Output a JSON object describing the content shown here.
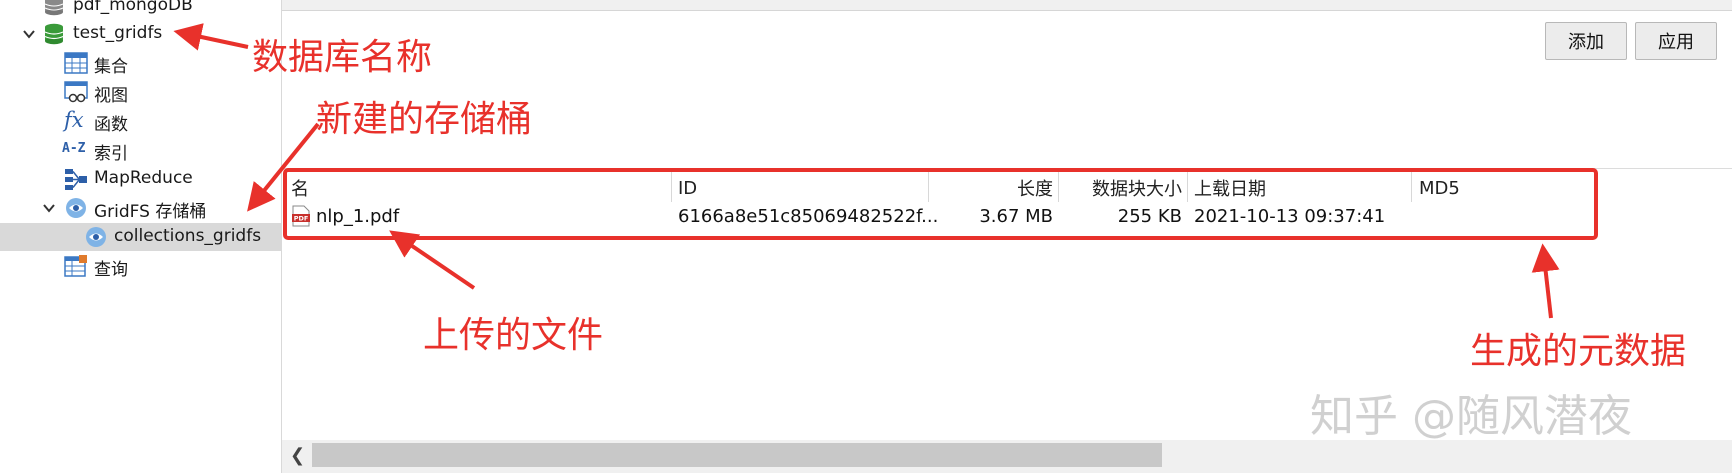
{
  "sidebar": {
    "items": [
      {
        "label": "pdf_mongoDB",
        "icon": "database-icon"
      },
      {
        "label": "test_gridfs",
        "icon": "database-icon"
      },
      {
        "label": "集合",
        "icon": "table-grid-icon"
      },
      {
        "label": "视图",
        "icon": "view-icon"
      },
      {
        "label": "函数",
        "icon": "function-icon"
      },
      {
        "label": "索引",
        "icon": "index-icon"
      },
      {
        "label": "MapReduce",
        "icon": "mapreduce-icon"
      },
      {
        "label": "GridFS 存储桶",
        "icon": "gridfs-bucket-icon"
      },
      {
        "label": "collections_gridfs",
        "icon": "gridfs-bucket-icon"
      },
      {
        "label": "查询",
        "icon": "query-icon"
      }
    ]
  },
  "buttons": {
    "add": "添加",
    "apply": "应用"
  },
  "table": {
    "columns": [
      "名",
      "ID",
      "长度",
      "数据块大小",
      "上载日期",
      "MD5"
    ],
    "rows": [
      {
        "name": "nlp_1.pdf",
        "id": "6166a8e51c85069482522f...",
        "length": "3.67 MB",
        "chunk_size": "255 KB",
        "upload_date": "2021-10-13 09:37:41",
        "md5": ""
      }
    ]
  },
  "annotations": {
    "db_name": "数据库名称",
    "new_bucket": "新建的存储桶",
    "uploaded_file": "上传的文件",
    "metadata": "生成的元数据"
  },
  "watermark": "知乎 @随风潜夜",
  "colors": {
    "annotation": "#e8312b",
    "selection": "#d9d9d9",
    "db_green": "#3a9a3a",
    "pdf_red": "#c8302c"
  }
}
